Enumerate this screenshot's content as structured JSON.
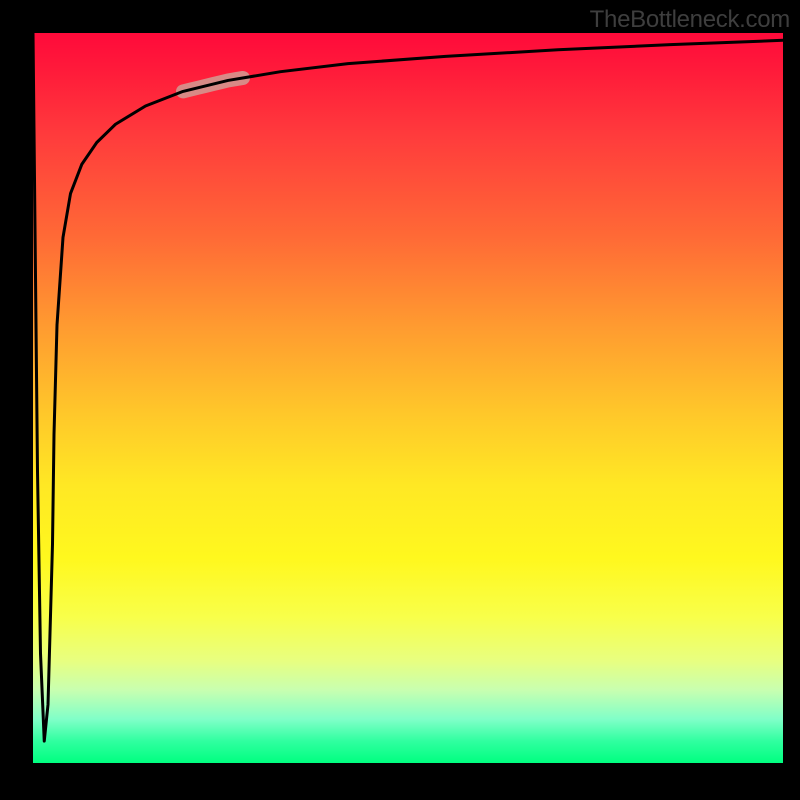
{
  "watermark": "TheBottleneck.com",
  "chart_data": {
    "type": "line",
    "title": "",
    "xlabel": "",
    "ylabel": "",
    "xlim": [
      0,
      100
    ],
    "ylim": [
      0,
      100
    ],
    "grid": false,
    "series": [
      {
        "name": "bottleneck-curve",
        "x": [
          0,
          0.3,
          0.6,
          1.0,
          1.5,
          2.0,
          2.6,
          2.8,
          3.2,
          4.0,
          5.0,
          6.5,
          8.5,
          11,
          15,
          20,
          26,
          33,
          42,
          55,
          70,
          85,
          100
        ],
        "values": [
          100,
          70,
          40,
          15,
          3,
          8,
          30,
          45,
          60,
          72,
          78,
          82,
          85,
          87.5,
          90,
          92,
          93.5,
          94.7,
          95.8,
          96.8,
          97.7,
          98.4,
          99
        ]
      }
    ],
    "markers": [
      {
        "name": "highlight-segment",
        "x_start": 20,
        "x_end": 28,
        "color": "#d88a86",
        "width": 14
      }
    ],
    "gradient_stops": [
      {
        "pos": 0,
        "color": "#ff0a3a"
      },
      {
        "pos": 50,
        "color": "#ffd028"
      },
      {
        "pos": 80,
        "color": "#f8ff4a"
      },
      {
        "pos": 100,
        "color": "#00ff80"
      }
    ]
  }
}
